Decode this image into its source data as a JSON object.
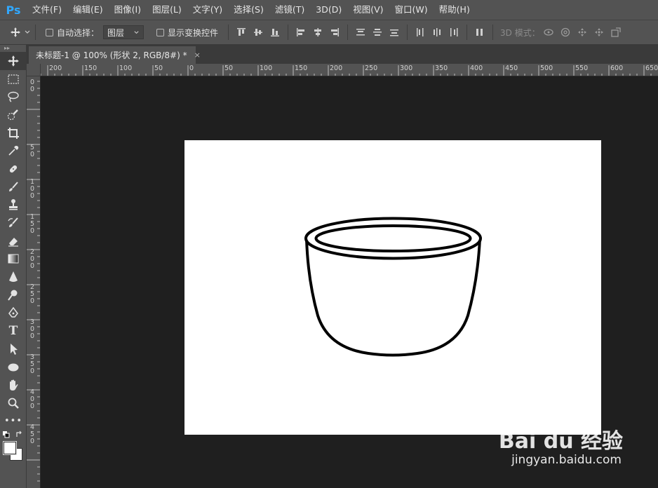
{
  "app": {
    "logo": "Ps"
  },
  "menu": [
    "文件(F)",
    "编辑(E)",
    "图像(I)",
    "图层(L)",
    "文字(Y)",
    "选择(S)",
    "滤镜(T)",
    "3D(D)",
    "视图(V)",
    "窗口(W)",
    "帮助(H)"
  ],
  "options": {
    "auto_select_label": "自动选择：",
    "layer_select_value": "图层",
    "show_transform_label": "显示变换控件",
    "mode3d_label": "3D 模式："
  },
  "document": {
    "tab_title": "未标题-1 @ 100% (形状 2, RGB/8#) *",
    "close_glyph": "×"
  },
  "ruler": {
    "h_labels": [
      "200",
      "150",
      "100",
      "50",
      "0",
      "50",
      "100",
      "150",
      "200",
      "250",
      "300",
      "350",
      "400",
      "450",
      "500",
      "550",
      "600",
      "650"
    ],
    "v_labels": [
      "0",
      "0",
      "5\n0",
      "1\n0\n0",
      "1\n5\n0",
      "2\n0\n0",
      "2\n5\n0",
      "3\n0\n0",
      "3\n5\n0",
      "4\n0\n0",
      "4\n5\n0"
    ]
  },
  "tools": [
    "move-tool",
    "marquee-tool",
    "lasso-tool",
    "quick-select-tool",
    "crop-tool",
    "eyedropper-tool",
    "healing-brush-tool",
    "brush-tool",
    "clone-stamp-tool",
    "history-brush-tool",
    "eraser-tool",
    "gradient-tool",
    "blur-tool",
    "dodge-tool",
    "pen-tool",
    "type-tool",
    "path-select-tool",
    "ellipse-tool",
    "hand-tool",
    "zoom-tool",
    "more-tools"
  ],
  "type_tool_glyph": "T",
  "more_tools_glyph": "•••",
  "watermark": {
    "brand": "Bai du 经验",
    "url": "jingyan.baidu.com"
  },
  "colors": {
    "accent": "#31a8ff",
    "panel": "#535353",
    "workspace": "#1f1f1f"
  }
}
